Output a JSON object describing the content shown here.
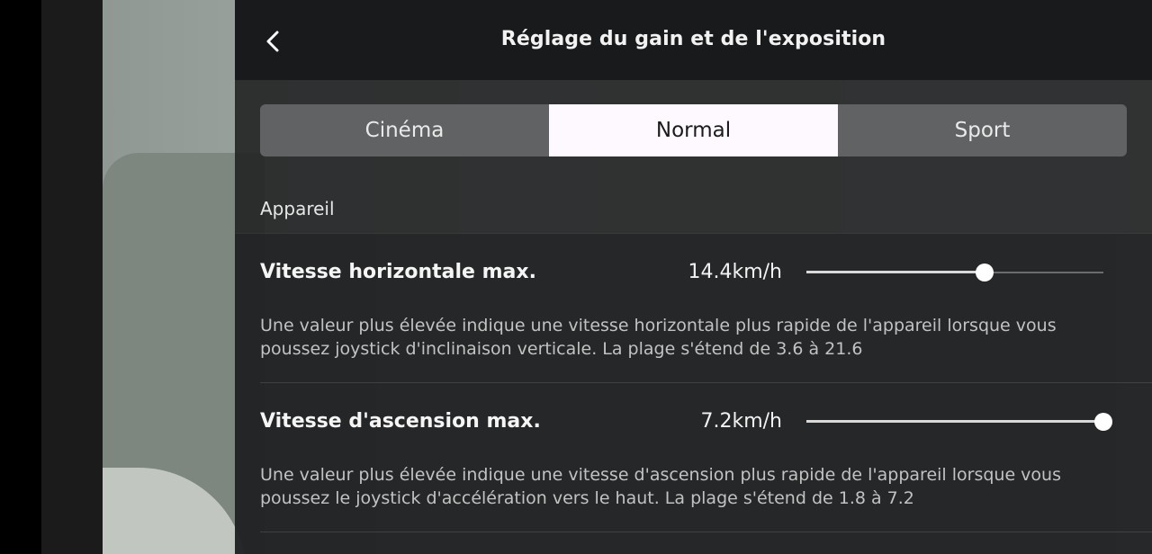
{
  "header": {
    "title": "Réglage du gain et de l'exposition",
    "back_icon": "chevron-left-icon"
  },
  "modes": {
    "tabs": [
      {
        "label": "Cinéma",
        "selected": false
      },
      {
        "label": "Normal",
        "selected": true
      },
      {
        "label": "Sport",
        "selected": false
      }
    ]
  },
  "section": {
    "label": "Appareil"
  },
  "settings": [
    {
      "label": "Vitesse horizontale max.",
      "value": "14.4km/h",
      "slider_fraction": 0.6,
      "description": "Une valeur plus élevée indique une vitesse horizontale plus rapide de l'appareil lorsque vous poussez joystick d'inclinaison verticale. La plage s'étend de 3.6 à 21.6"
    },
    {
      "label": "Vitesse d'ascension max.",
      "value": "7.2km/h",
      "slider_fraction": 1.0,
      "description": "Une valeur plus élevée indique une vitesse d'ascension plus rapide de l'appareil lorsque vous poussez le joystick d'accélération vers le haut. La plage s'étend de 1.8 à 7.2"
    }
  ],
  "colors": {
    "panel_bg": "#222325",
    "selected_tab_bg": "#fdf9fe",
    "tab_bg": "#616263",
    "slider_thumb": "#ffffff"
  }
}
